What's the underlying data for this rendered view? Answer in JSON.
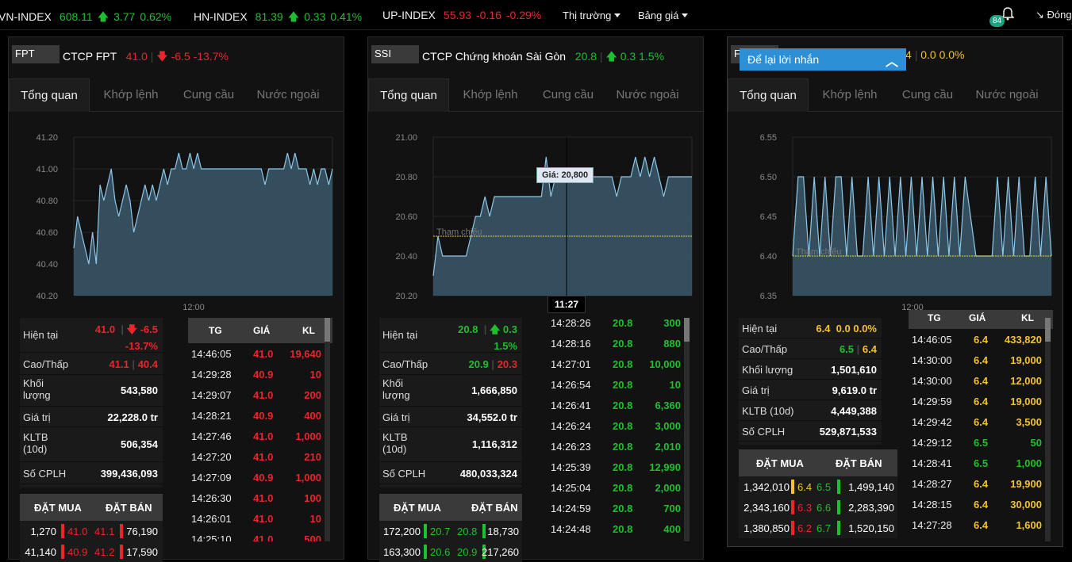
{
  "indices": [
    {
      "name": "VN-INDEX",
      "value": "608.11",
      "change": "3.77",
      "pct": "0.62%",
      "dir": "up"
    },
    {
      "name": "HN-INDEX",
      "value": "81.39",
      "change": "0.33",
      "pct": "0.41%",
      "dir": "up"
    },
    {
      "name": "UP-INDEX",
      "value": "55.93",
      "change": "-0.16",
      "pct": "-0.29%",
      "dir": "down"
    }
  ],
  "menu": {
    "market": "Thị trường",
    "board": "Bảng giá"
  },
  "notifications": "84",
  "close_label": "Đóng",
  "message_widget": "Để lại lời nhắn",
  "tabs": [
    "Tổng quan",
    "Khớp lệnh",
    "Cung cầu",
    "Nước ngoài"
  ],
  "labels": {
    "current": "Hiện tại",
    "highlow": "Cao/Thấp",
    "volume": "Khối lượng",
    "volume_split_a": "Khối",
    "volume_split_b": "lượng",
    "value": "Giá trị",
    "avg10_a": "KLTB",
    "avg10_b": "(10d)",
    "avg10": "KLTB (10d)",
    "shares": "Số CPLH",
    "bid": "ĐẶT MUA",
    "ask": "ĐẶT BÁN",
    "tape_time": "TG",
    "tape_price": "GIÁ",
    "tape_vol": "KL",
    "ref_line": "Tham chiếu",
    "x_tick": "12:00"
  },
  "panels": [
    {
      "symbol": "FPT",
      "name": "CTCP FPT",
      "price": "41.0",
      "change": "-6.5",
      "pct": "-13.7%",
      "dir": "down",
      "current": "41.0",
      "cur_change": "-6.5",
      "cur_pct": "-13.7%",
      "high": "41.1",
      "low": "40.4",
      "volume": "543,580",
      "value": "22,228.0 tr",
      "avg10": "506,354",
      "shares": "399,436,093",
      "book": [
        [
          "1,270",
          "41.0",
          "41.1",
          "76,190"
        ],
        [
          "41,140",
          "40.9",
          "41.2",
          "17,590"
        ]
      ],
      "tape": [
        [
          "14:46:05",
          "41.0",
          "19,640"
        ],
        [
          "14:29:28",
          "40.9",
          "10"
        ],
        [
          "14:29:07",
          "41.0",
          "200"
        ],
        [
          "14:28:21",
          "40.9",
          "400"
        ],
        [
          "14:27:46",
          "41.0",
          "1,000"
        ],
        [
          "14:27:20",
          "41.0",
          "210"
        ],
        [
          "14:27:09",
          "40.9",
          "1,000"
        ],
        [
          "14:26:30",
          "41.0",
          "100"
        ],
        [
          "14:26:01",
          "41.0",
          "10"
        ],
        [
          "14:25:10",
          "41.0",
          "500"
        ]
      ]
    },
    {
      "symbol": "SSI",
      "name": "CTCP Chứng khoán Sài Gòn",
      "price": "20.8",
      "change": "0.3",
      "pct": "1.5%",
      "dir": "up",
      "current": "20.8",
      "cur_change": "0.3",
      "cur_pct": "1.5%",
      "high": "20.9",
      "low": "20.3",
      "volume": "1,666,850",
      "value": "34,552.0 tr",
      "avg10": "1,116,312",
      "shares": "480,033,324",
      "book": [
        [
          "172,200",
          "20.7",
          "20.8",
          "18,730"
        ],
        [
          "163,300",
          "20.6",
          "20.9",
          "217,260"
        ]
      ],
      "tape": [
        [
          "14:28:26",
          "20.8",
          "300"
        ],
        [
          "14:28:16",
          "20.8",
          "880"
        ],
        [
          "14:27:01",
          "20.8",
          "10,000"
        ],
        [
          "14:26:54",
          "20.8",
          "10"
        ],
        [
          "14:26:41",
          "20.8",
          "6,360"
        ],
        [
          "14:26:24",
          "20.8",
          "3,000"
        ],
        [
          "14:26:23",
          "20.8",
          "2,010"
        ],
        [
          "14:25:39",
          "20.8",
          "12,990"
        ],
        [
          "14:25:04",
          "20.8",
          "2,000"
        ],
        [
          "14:24:59",
          "20.8",
          "700"
        ],
        [
          "14:24:48",
          "20.8",
          "400"
        ]
      ],
      "tooltip": "Giá: 20,800",
      "cursor_time": "11:27"
    },
    {
      "symbol": "F",
      "name": "",
      "price": "4",
      "change": "0.0",
      "pct": "0.0%",
      "dir": "ref",
      "current": "6.4",
      "cur_change": "0.0",
      "cur_pct": "0.0%",
      "high": "6.5",
      "low": "6.4",
      "volume": "1,501,610",
      "value": "9,619.0 tr",
      "avg10": "4,449,388",
      "shares": "529,871,533",
      "book": [
        [
          "1,342,010",
          "6.4",
          "6.5",
          "1,499,140"
        ],
        [
          "2,343,160",
          "6.3",
          "6.6",
          "2,283,390"
        ],
        [
          "1,380,850",
          "6.2",
          "6.7",
          "1,520,150"
        ]
      ],
      "tape": [
        [
          "14:46:05",
          "6.4",
          "433,820"
        ],
        [
          "14:30:00",
          "6.4",
          "19,000"
        ],
        [
          "14:30:00",
          "6.4",
          "12,000"
        ],
        [
          "14:29:59",
          "6.4",
          "19,000"
        ],
        [
          "14:29:42",
          "6.4",
          "3,500"
        ],
        [
          "14:29:12",
          "6.5",
          "50"
        ],
        [
          "14:28:41",
          "6.5",
          "1,000"
        ],
        [
          "14:28:27",
          "6.4",
          "19,900"
        ],
        [
          "14:28:15",
          "6.4",
          "30,000"
        ],
        [
          "14:27:28",
          "6.4",
          "1,600"
        ]
      ]
    }
  ],
  "chart_data": [
    {
      "type": "area",
      "title": "",
      "ylim": [
        40.2,
        41.2
      ],
      "y_ticks": [
        "41.20",
        "41.00",
        "40.80",
        "40.60",
        "40.40",
        "40.20"
      ],
      "x_ticks": [
        "12:00"
      ],
      "reference": null,
      "values": [
        40.5,
        40.7,
        40.6,
        40.5,
        40.4,
        40.6,
        40.4,
        40.9,
        40.8,
        40.9,
        41.0,
        40.8,
        40.7,
        40.8,
        40.9,
        40.8,
        40.6,
        40.7,
        40.8,
        40.9,
        40.8,
        40.9,
        40.8,
        40.9,
        41.0,
        40.9,
        41.0,
        41.0,
        41.1,
        41.0,
        41.0,
        41.1,
        41.0,
        41.1,
        41.0,
        41.0,
        41.0,
        41.0,
        41.0,
        41.0,
        41.0,
        41.0,
        41.0,
        41.0,
        41.0,
        41.0,
        41.0,
        41.0,
        41.0,
        41.0,
        41.0,
        40.9,
        41.0,
        41.0,
        41.0,
        41.0,
        41.0,
        41.1,
        41.0,
        41.1,
        41.0,
        41.0,
        41.0,
        40.9,
        41.0,
        40.9,
        41.0,
        41.0,
        40.9,
        41.0
      ]
    },
    {
      "type": "area",
      "title": "",
      "ylim": [
        20.2,
        21.0
      ],
      "y_ticks": [
        "21.00",
        "20.80",
        "20.60",
        "20.40",
        "20.20"
      ],
      "x_ticks": [],
      "reference": 20.5,
      "values": [
        20.3,
        20.5,
        20.4,
        20.4,
        20.4,
        20.4,
        20.4,
        20.4,
        20.5,
        20.6,
        20.6,
        20.7,
        20.6,
        20.7,
        20.7,
        20.7,
        20.7,
        20.7,
        20.7,
        20.7,
        20.7,
        20.7,
        20.7,
        20.7,
        20.9,
        20.7,
        20.8,
        20.8,
        20.8,
        20.8,
        20.8,
        20.8,
        20.8,
        20.8,
        20.8,
        20.8,
        20.8,
        20.8,
        20.8,
        20.7,
        20.8,
        20.8,
        20.8,
        20.9,
        20.8,
        20.9,
        20.8,
        20.9,
        20.8,
        20.7,
        20.8,
        20.8,
        20.8,
        20.8,
        20.8,
        20.8
      ]
    },
    {
      "type": "area",
      "title": "",
      "ylim": [
        6.35,
        6.55
      ],
      "y_ticks": [
        "6.55",
        "6.50",
        "6.45",
        "6.40",
        "6.35"
      ],
      "x_ticks": [
        "12:00"
      ],
      "reference": 6.4,
      "values": [
        6.4,
        6.5,
        6.5,
        6.4,
        6.5,
        6.4,
        6.5,
        6.4,
        6.5,
        6.5,
        6.4,
        6.5,
        6.4,
        6.4,
        6.5,
        6.4,
        6.5,
        6.4,
        6.5,
        6.4,
        6.5,
        6.4,
        6.5,
        6.4,
        6.5,
        6.4,
        6.5,
        6.4,
        6.5,
        6.4,
        6.5,
        6.4,
        6.5,
        6.45,
        6.4,
        6.4,
        6.4,
        6.4,
        6.5,
        6.4,
        6.5,
        6.4,
        6.5,
        6.4,
        6.4,
        6.5,
        6.4,
        6.5,
        6.4
      ]
    }
  ]
}
